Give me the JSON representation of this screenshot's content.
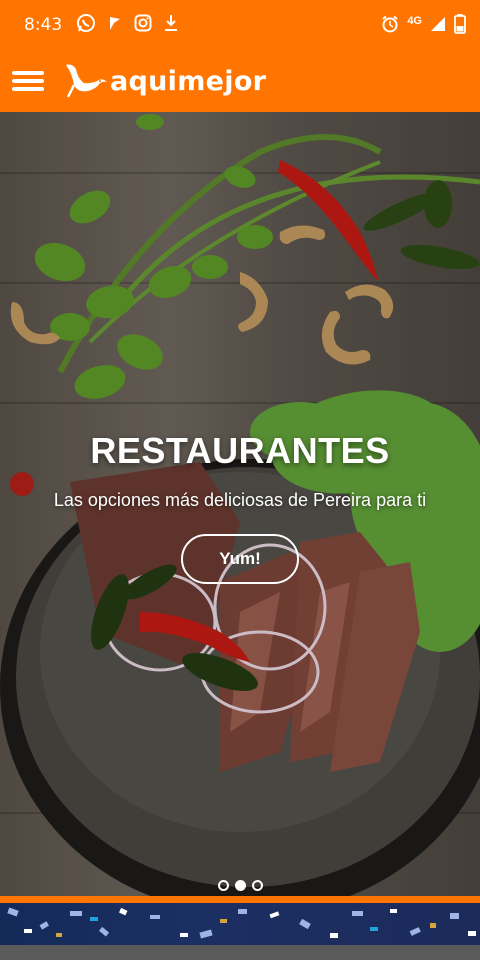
{
  "status_bar": {
    "time": "8:43",
    "network": "4G",
    "left_icons": [
      "whatsapp-icon",
      "flag-icon",
      "instagram-icon",
      "download-icon"
    ],
    "right_icons": [
      "alarm-icon",
      "signal-icon",
      "battery-icon"
    ]
  },
  "app_bar": {
    "brand": "aquimejor",
    "menu_icon": "menu-icon",
    "logo_icon": "bird-logo-icon"
  },
  "hero": {
    "title": "RESTAURANTES",
    "subtitle": "Las opciones más deliciosas de Pereira para ti",
    "button_label": "Yum!",
    "slides": 3,
    "active_slide": 2
  },
  "colors": {
    "brand_orange": "#ff7500",
    "white": "#ffffff",
    "banner_blue": "#1c2f63"
  }
}
